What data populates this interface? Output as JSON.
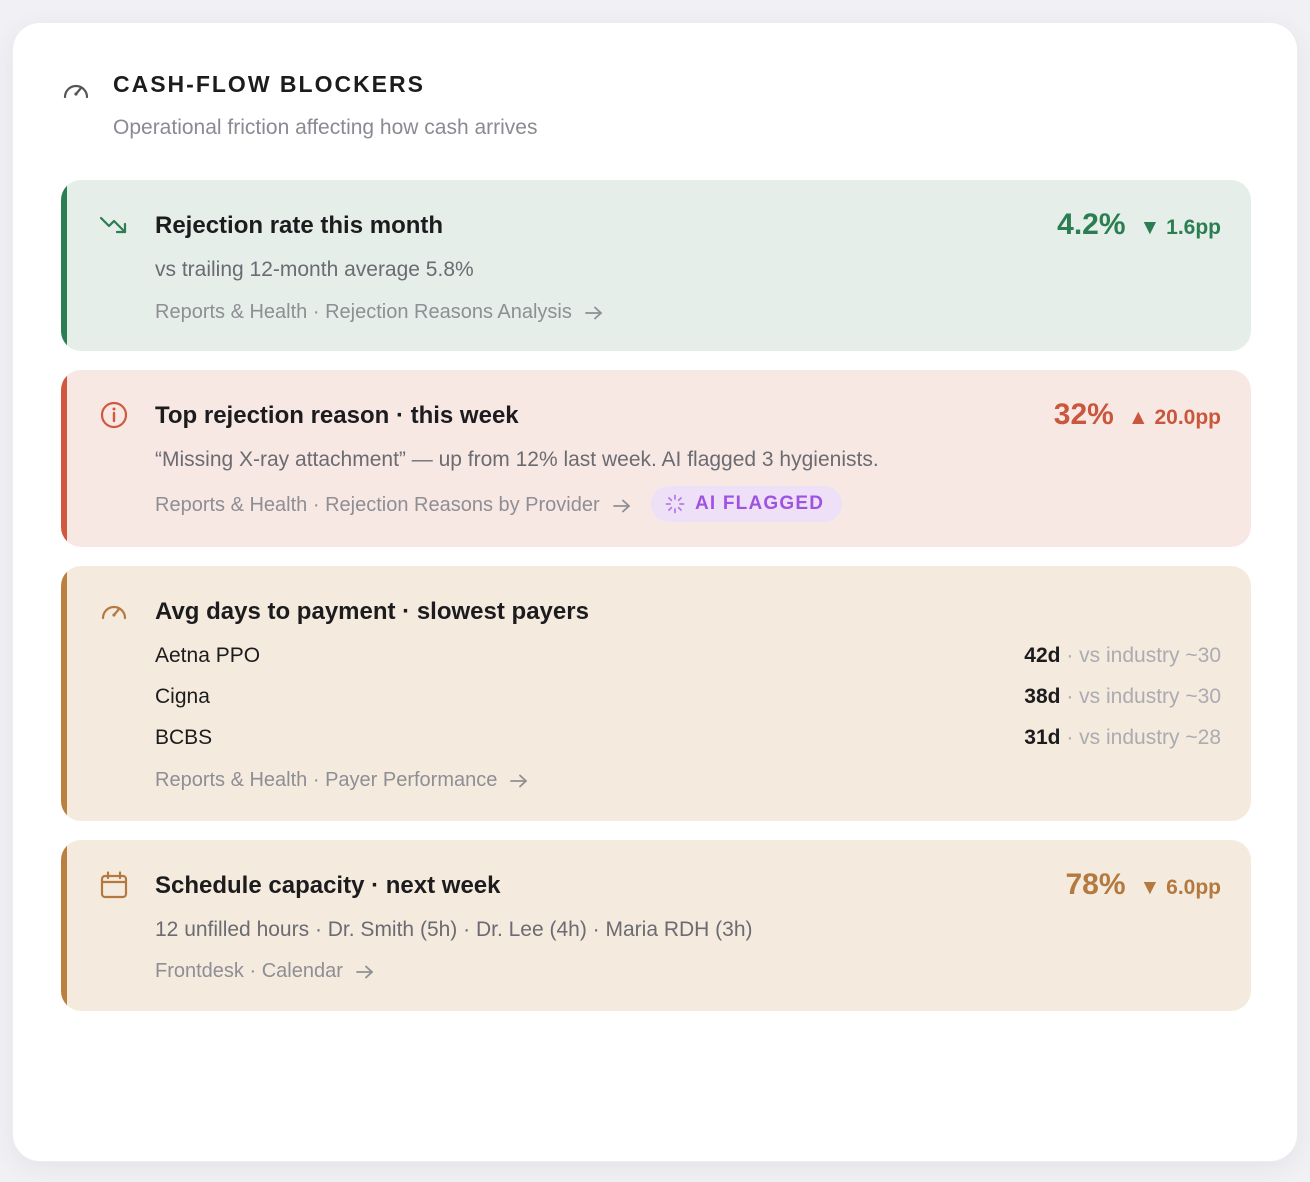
{
  "panel": {
    "title": "CASH-FLOW BLOCKERS",
    "subtitle": "Operational friction affecting how cash arrives",
    "icon": "gauge-icon"
  },
  "cards": {
    "rejection_rate": {
      "icon": "trending-down-icon",
      "title": "Rejection rate this month",
      "description": "vs trailing 12-month average 5.8%",
      "link": "Reports & Health · Rejection Reasons Analysis",
      "value": "4.2%",
      "delta": "▼ 1.6pp",
      "accent_color": "#2b7d52"
    },
    "top_reason": {
      "icon": "info-circle-icon",
      "title": "Top rejection reason · this week",
      "description": "“Missing X-ray attachment” — up from 12% last week. AI flagged 3 hygienists.",
      "link": "Reports & Health · Rejection Reasons by Provider",
      "badge": "AI FLAGGED",
      "badge_icon": "sparkle-loader-icon",
      "value": "32%",
      "delta": "▲ 20.0pp",
      "accent_color": "#d0583e"
    },
    "days_to_payment": {
      "icon": "gauge-icon",
      "title": "Avg days to payment · slowest payers",
      "payers": [
        {
          "name": "Aetna PPO",
          "days": "42d",
          "industry": "vs industry ~30"
        },
        {
          "name": "Cigna",
          "days": "38d",
          "industry": "vs industry ~30"
        },
        {
          "name": "BCBS",
          "days": "31d",
          "industry": "vs industry ~28"
        }
      ],
      "separator": "·",
      "link": "Reports & Health · Payer Performance",
      "accent_color": "#b98040"
    },
    "schedule_capacity": {
      "icon": "calendar-icon",
      "title": "Schedule capacity · next week",
      "description": "12 unfilled hours · Dr. Smith (5h) · Dr. Lee (4h) · Maria RDH (3h)",
      "link": "Frontdesk · Calendar",
      "value": "78%",
      "delta": "▼ 6.0pp",
      "accent_color": "#b98040"
    }
  }
}
